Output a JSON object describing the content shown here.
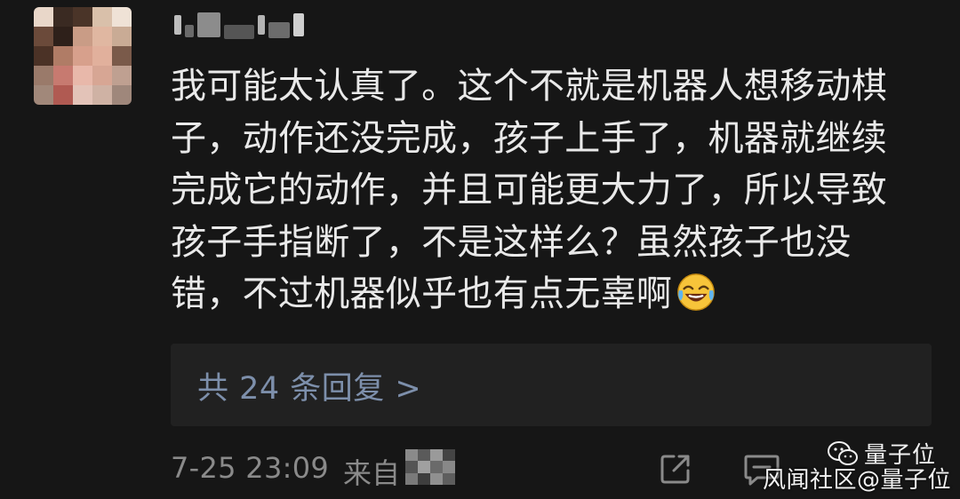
{
  "comment": {
    "lines": [
      "我可能太认真了。这个不就是机器人想移动棋",
      "子，动作还没完成，孩子上手了，机器就继续",
      "完成它的动作，并且可能更大力了，所以导致",
      "孩子手指断了，不是这样么？虽然孩子也没",
      "错，不过机器似乎也有点无辜啊"
    ],
    "emoji": "laugh-cry-emoji"
  },
  "replies": {
    "label": "共 24 条回复 >"
  },
  "footer": {
    "timestamp": "7-25 23:09",
    "from_label": "来自"
  },
  "watermark": {
    "brand": "量子位",
    "source": "风闻社区@量子位"
  },
  "colors": {
    "background": "#161616",
    "text": "#e9e9e9",
    "link": "#7d8fab",
    "meta": "#8a8a8a",
    "reply_box": "#212121"
  }
}
